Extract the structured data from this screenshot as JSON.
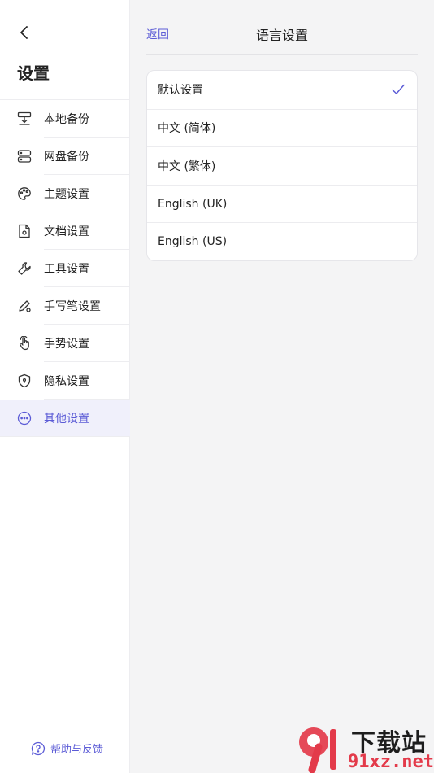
{
  "sidebar": {
    "title": "设置",
    "items": [
      {
        "label": "本地备份",
        "icon": "local-backup-icon"
      },
      {
        "label": "网盘备份",
        "icon": "cloud-backup-icon"
      },
      {
        "label": "主题设置",
        "icon": "palette-icon"
      },
      {
        "label": "文档设置",
        "icon": "document-settings-icon"
      },
      {
        "label": "工具设置",
        "icon": "wrench-icon"
      },
      {
        "label": "手写笔设置",
        "icon": "pen-icon"
      },
      {
        "label": "手势设置",
        "icon": "hand-gesture-icon"
      },
      {
        "label": "隐私设置",
        "icon": "shield-icon"
      },
      {
        "label": "其他设置",
        "icon": "more-circle-icon",
        "active": true
      }
    ],
    "help_label": "帮助与反馈"
  },
  "header": {
    "back_label": "返回",
    "title": "语言设置"
  },
  "languages": [
    {
      "label": "默认设置",
      "selected": true
    },
    {
      "label": "中文 (简体)",
      "selected": false
    },
    {
      "label": "中文 (繁体)",
      "selected": false
    },
    {
      "label": "English (UK)",
      "selected": false
    },
    {
      "label": "English (US)",
      "selected": false
    }
  ],
  "watermark": {
    "top_text": "下载站",
    "bottom_text": "91xz.net"
  },
  "colors": {
    "accent": "#5b5bd6",
    "watermark_red": "#e33a4a"
  }
}
